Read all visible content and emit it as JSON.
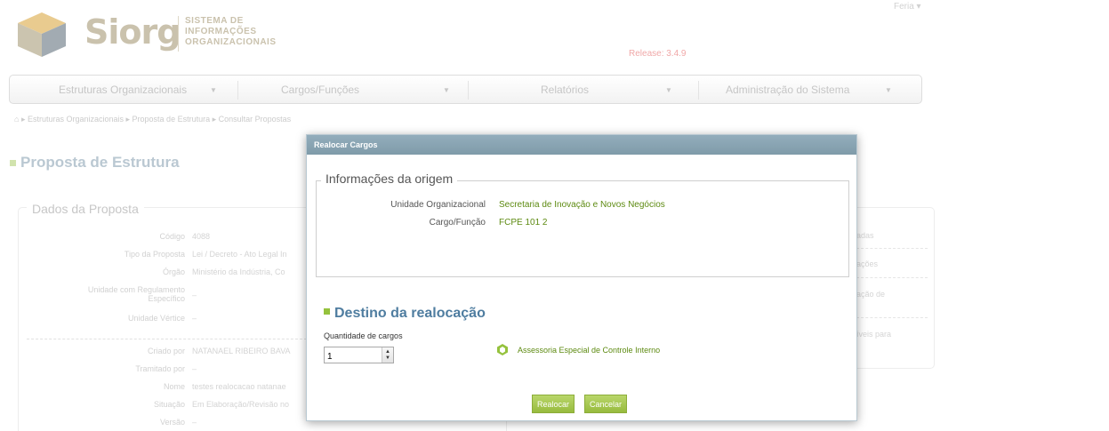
{
  "header": {
    "logo_word": "Siorg",
    "logo_sub_1": "SISTEMA DE",
    "logo_sub_2": "INFORMAÇÕES",
    "logo_sub_3": "ORGANIZACIONAIS",
    "release": "Release: 3.4.9",
    "user_menu": "Feria ▾"
  },
  "nav": {
    "items": [
      {
        "label": "Estruturas Organizacionais"
      },
      {
        "label": "Cargos/Funções"
      },
      {
        "label": "Relatórios"
      },
      {
        "label": "Administração do Sistema"
      }
    ]
  },
  "breadcrumb": "▸ Estruturas Organizacionais ▸ Proposta de Estrutura ▸ Consultar Propostas",
  "page_title": "Proposta de Estrutura",
  "dados": {
    "legend": "Dados da Proposta",
    "rows": [
      {
        "label": "Código",
        "value": "4088"
      },
      {
        "label": "Tipo da Proposta",
        "value": "Lei / Decreto - Ato Legal In"
      },
      {
        "label": "Órgão",
        "value": "Ministério da Indústria, Co"
      },
      {
        "label": "Unidade com Regulamento Específico",
        "value": "–"
      },
      {
        "label": "Unidade Vértice",
        "value": "–"
      },
      {
        "label": "Criado por",
        "value": "NATANAEL RIBEIRO BAVA"
      },
      {
        "label": "Tramitado por",
        "value": "–"
      },
      {
        "label": "Nome",
        "value": "testes realocacao natanae"
      },
      {
        "label": "Situação",
        "value": "Em Elaboração/Revisão no"
      },
      {
        "label": "Versão",
        "value": "–"
      }
    ]
  },
  "right_panel": {
    "items": [
      "adas",
      "ações",
      "ação de",
      "íveis para"
    ]
  },
  "modal": {
    "title": "Realocar Cargos",
    "origem": {
      "legend": "Informações da origem",
      "unit_label": "Unidade Organizacional",
      "unit_value": "Secretaria de Inovação e Novos Negócios",
      "cargo_label": "Cargo/Função",
      "cargo_value": "FCPE 101 2"
    },
    "destino": {
      "title": "Destino da realocação",
      "qty_label": "Quantidade de cargos",
      "qty_value": "1",
      "unit_name": "Assessoria Especial de Controle Interno"
    },
    "buttons": {
      "realocar": "Realocar",
      "cancelar": "Cancelar"
    }
  },
  "colors": {
    "accent_green": "#95c23d",
    "link_green": "#5d8a11",
    "modal_header": "#8aa5b4",
    "title_blue": "#4f7da0"
  }
}
